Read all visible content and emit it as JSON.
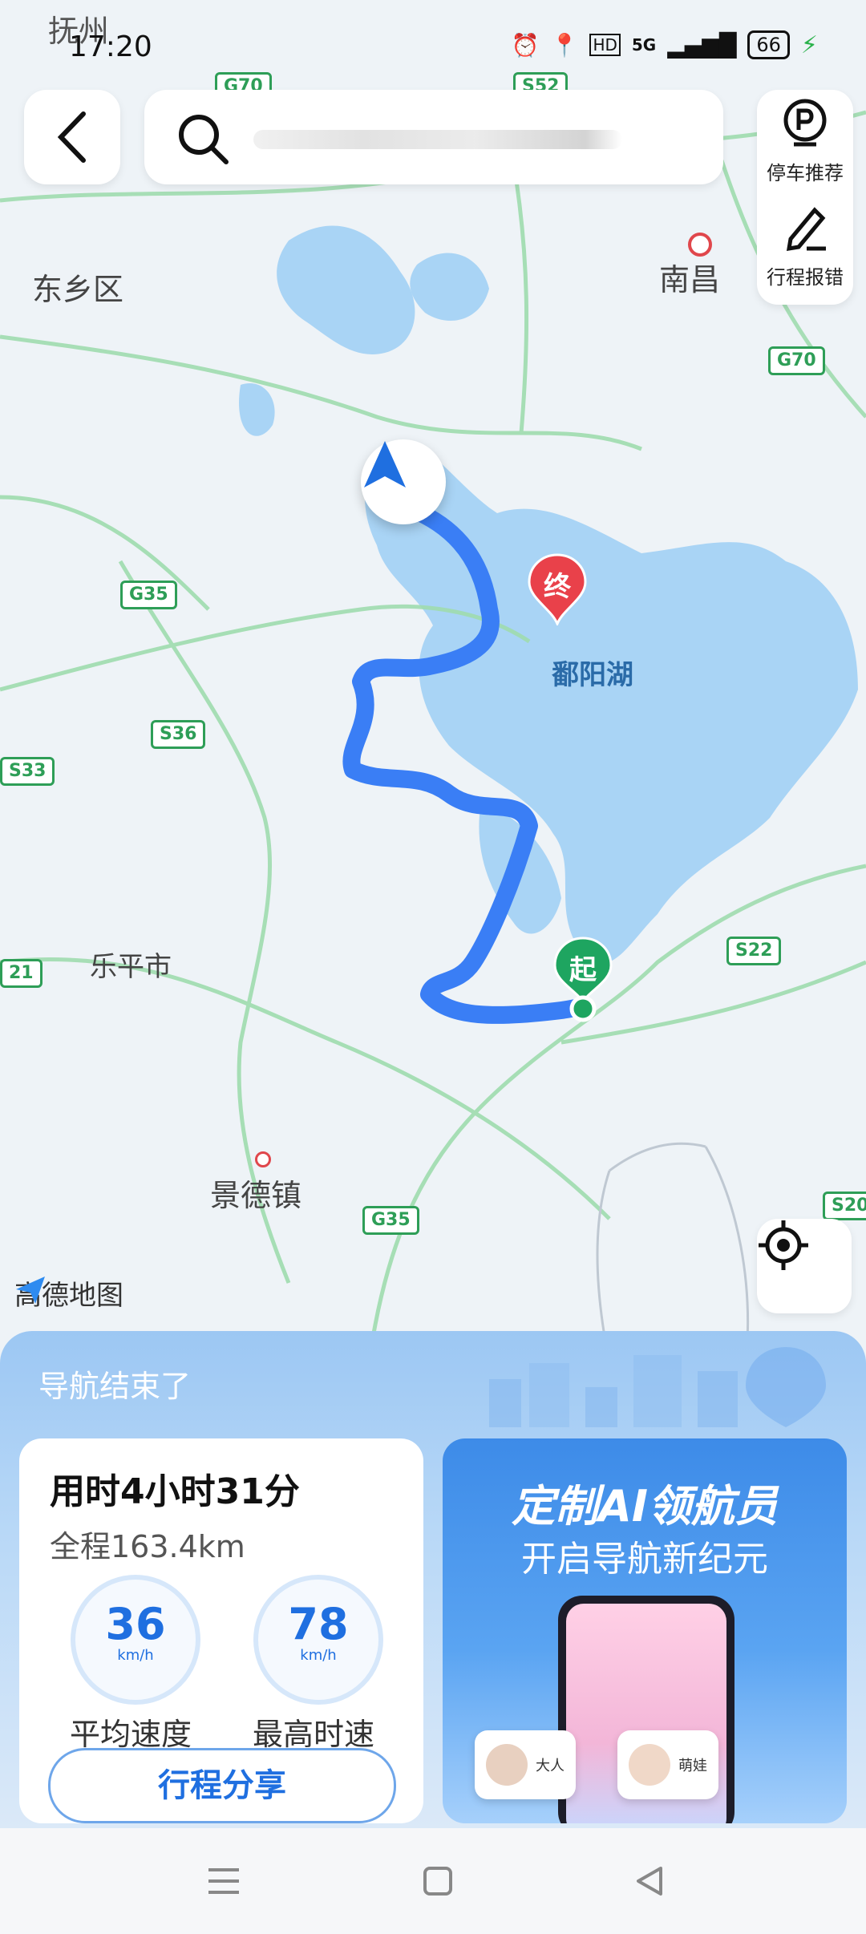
{
  "status_bar": {
    "time": "17:20",
    "corner_label": "抚州",
    "network": "5G",
    "battery": "66"
  },
  "search": {
    "back_label": "返回"
  },
  "side_panel": {
    "parking_label": "停车推荐",
    "report_label": "行程报错"
  },
  "map": {
    "labels": {
      "dongxiang": "东乡区",
      "nanchang": "南昌",
      "lake": "鄱阳湖",
      "leping": "乐平市",
      "jingdezhen": "景德镇"
    },
    "roads": [
      "G70",
      "S52",
      "G70",
      "G35",
      "S36",
      "S33",
      "G35",
      "S22",
      "S20",
      "21"
    ],
    "start_marker": "起",
    "end_marker": "终",
    "brand": "高德地图"
  },
  "summary": {
    "title": "导航结束了",
    "duration": "用时4小时31分",
    "distance": "全程163.4km",
    "avg_speed": "36",
    "max_speed": "78",
    "speed_unit": "km/h",
    "avg_label": "平均速度",
    "max_label": "最高时速",
    "share_button": "行程分享"
  },
  "promo": {
    "title": "定制AI领航员",
    "subtitle": "开启导航新纪元",
    "chip_left": "大人",
    "chip_right": "萌娃"
  }
}
